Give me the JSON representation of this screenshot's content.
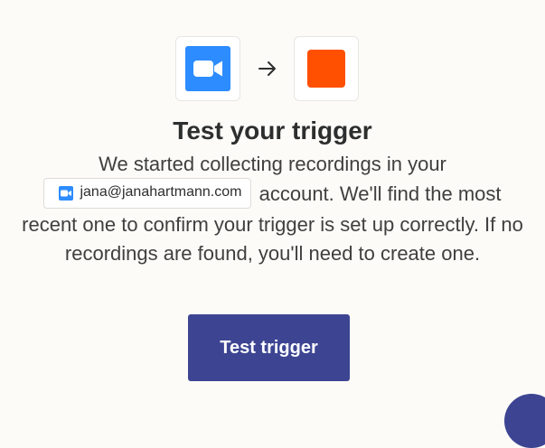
{
  "trigger": {
    "title": "Test your trigger",
    "desc_before": "We started collecting recordings in your",
    "account_email": "jana@janahartmann.com",
    "desc_after": "account. We'll find the most recent one to confirm your trigger is set up correctly. If no recordings are found, you'll need to create one.",
    "button_label": "Test trigger"
  },
  "icons": {
    "source_app": "zoom-video-camera-icon",
    "connector": "arrow-right-icon",
    "destination_app": "orange-square-app-icon",
    "help": "help-chat-icon"
  },
  "colors": {
    "background": "#fdfbf8",
    "zoom_blue": "#2d8cff",
    "zapier_orange": "#ff4f00",
    "primary_button": "#3d4592",
    "text": "#2d2e2e"
  }
}
